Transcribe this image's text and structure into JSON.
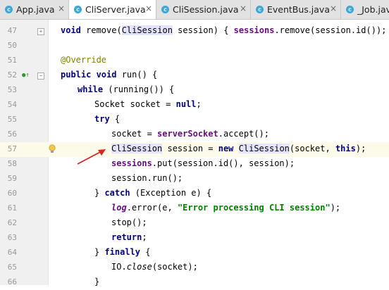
{
  "tabs": [
    {
      "label": "App.java",
      "icon": "java-class-icon",
      "active": false
    },
    {
      "label": "CliServer.java",
      "icon": "java-class-icon",
      "active": true
    },
    {
      "label": "CliSession.java",
      "icon": "java-class-icon",
      "active": false
    },
    {
      "label": "EventBus.java",
      "icon": "java-class-icon",
      "active": false
    },
    {
      "label": "_Job.java",
      "icon": "java-class-icon",
      "active": false
    }
  ],
  "close_glyph": "×",
  "line_numbers": [
    "47",
    "50",
    "51",
    "52",
    "53",
    "54",
    "55",
    "56",
    "57",
    "58",
    "59",
    "60",
    "61",
    "62",
    "63",
    "64",
    "65",
    "66"
  ],
  "code": {
    "l47": {
      "a": "void",
      "b": " remove(",
      "c": "CliSession",
      "d": " session) { ",
      "e": "sessions",
      "f": ".remove(session.id()); }"
    },
    "l51": {
      "a": "@Override"
    },
    "l52": {
      "a": "public void",
      "b": " run() {"
    },
    "l53": {
      "a": "while",
      "b": " (running()) {"
    },
    "l54": {
      "a": "Socket socket = ",
      "b": "null",
      "c": ";"
    },
    "l55": {
      "a": "try",
      "b": " {"
    },
    "l56": {
      "a": "socket = ",
      "b": "serverSocket",
      "c": ".accept();"
    },
    "l57": {
      "a": "CliSession",
      "b": " session = ",
      "c": "new",
      "d": " ",
      "e": "CliSession",
      "f": "(socket, ",
      "g": "this",
      "h": ");"
    },
    "l58": {
      "a": "sessions",
      "b": ".put(session.id(), session);"
    },
    "l59": {
      "a": "session.run();"
    },
    "l60": {
      "a": "} ",
      "b": "catch",
      "c": " (Exception e) {"
    },
    "l61": {
      "a": "log",
      "b": ".error(e, ",
      "c": "\"Error processing CLI session\"",
      "d": ");"
    },
    "l62": {
      "a": "stop();"
    },
    "l63": {
      "a": "return",
      "b": ";"
    },
    "l64": {
      "a": "} ",
      "b": "finally",
      "c": " {"
    },
    "l65": {
      "a": "IO.",
      "b": "close",
      "c": "(socket);"
    },
    "l66": {
      "a": "}"
    }
  },
  "colors": {
    "keyword": "#000080",
    "field": "#660e7a",
    "string": "#008000",
    "annotation": "#808000",
    "current_line": "#fcfae8",
    "arrow": "#d6261e"
  }
}
